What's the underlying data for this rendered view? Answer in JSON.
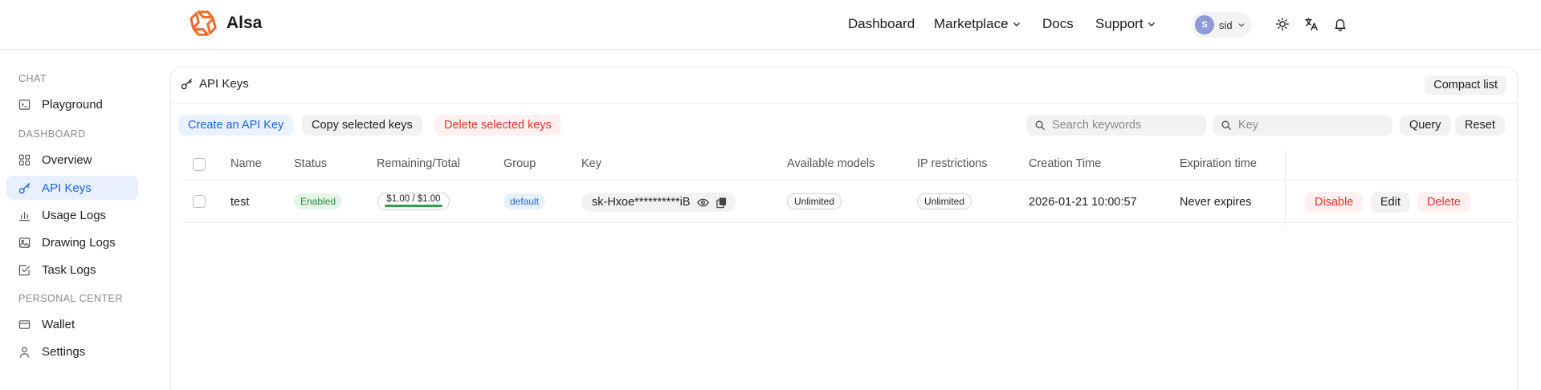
{
  "brand": {
    "name": "Alsa"
  },
  "nav": {
    "items": [
      {
        "label": "Dashboard"
      },
      {
        "label": "Marketplace"
      },
      {
        "label": "Docs"
      },
      {
        "label": "Support"
      }
    ],
    "user": {
      "initial": "S",
      "name": "sid"
    }
  },
  "sidebar": {
    "sections": [
      {
        "label": "CHAT"
      },
      {
        "label": "DASHBOARD"
      },
      {
        "label": "PERSONAL CENTER"
      }
    ],
    "items": [
      {
        "label": "Playground"
      },
      {
        "label": "Overview"
      },
      {
        "label": "API Keys"
      },
      {
        "label": "Usage Logs"
      },
      {
        "label": "Drawing Logs"
      },
      {
        "label": "Task Logs"
      },
      {
        "label": "Wallet"
      },
      {
        "label": "Settings"
      }
    ]
  },
  "card": {
    "title": "API Keys",
    "compact_label": "Compact list"
  },
  "toolbar": {
    "create_label": "Create an API Key",
    "copy_label": "Copy selected keys",
    "delete_label": "Delete selected keys",
    "search_placeholder": "Search keywords",
    "key_placeholder": "Key",
    "query_label": "Query",
    "reset_label": "Reset"
  },
  "table": {
    "columns": [
      "Name",
      "Status",
      "Remaining/Total",
      "Group",
      "Key",
      "Available models",
      "IP restrictions",
      "Creation Time",
      "Expiration time"
    ],
    "rows": [
      {
        "name": "test",
        "status": "Enabled",
        "quota": "$1.00 / $1.00",
        "quota_remaining_fraction": 1.0,
        "group": "default",
        "key": "sk-Hxoe**********iB",
        "models": "Unlimited",
        "ip": "Unlimited",
        "created": "2026-01-21 10:00:57",
        "expires": "Never expires",
        "actions": {
          "disable": "Disable",
          "edit": "Edit",
          "delete": "Delete"
        }
      }
    ]
  },
  "colors": {
    "accent": "#1a62e6",
    "danger": "#e5352b",
    "success": "#2aa34a",
    "logo": "#f26b2a"
  }
}
